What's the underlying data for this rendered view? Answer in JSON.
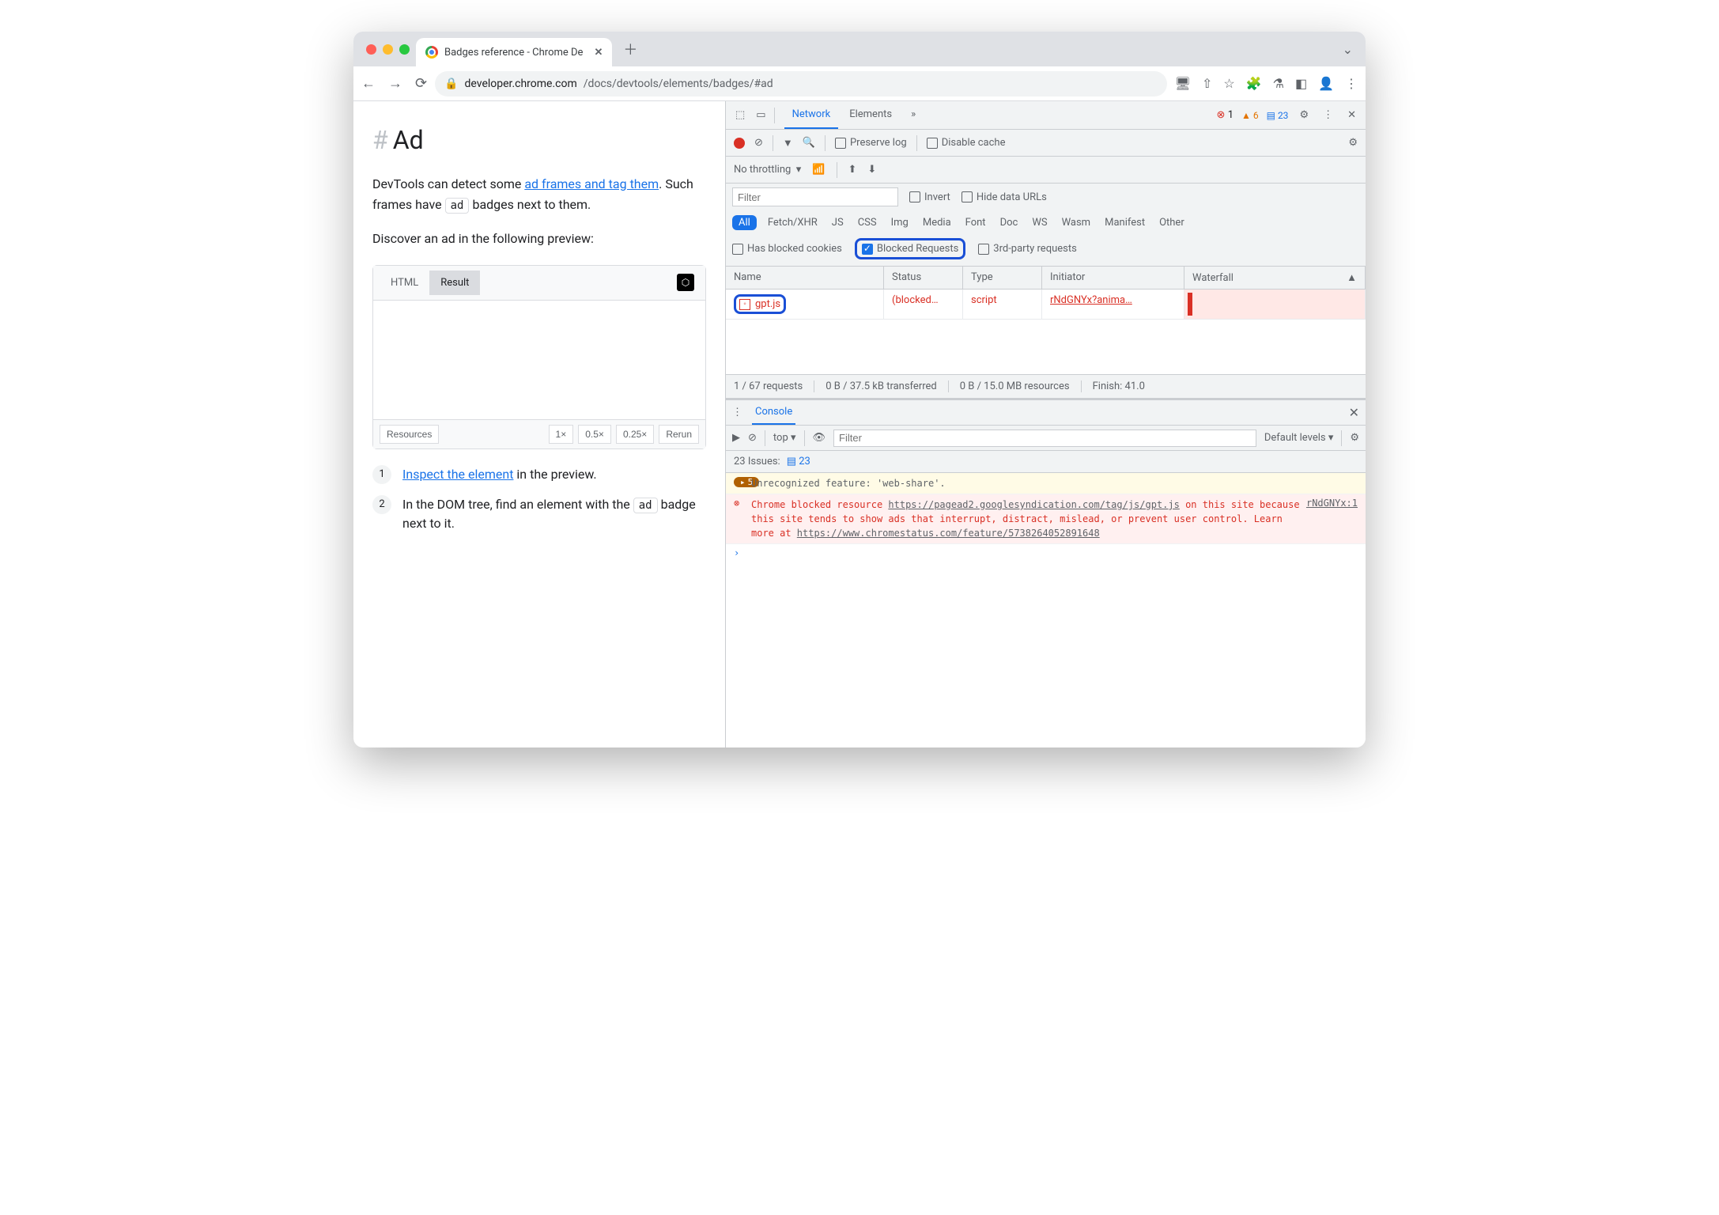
{
  "browser": {
    "tab_title": "Badges reference - Chrome De",
    "url_host": "developer.chrome.com",
    "url_path": "/docs/devtools/elements/badges/#ad"
  },
  "page": {
    "heading": "Ad",
    "p1_a": "DevTools can detect some ",
    "p1_link": "ad frames and tag them",
    "p1_b": ". Such frames have ",
    "p1_badge": "ad",
    "p1_c": " badges next to them.",
    "p2": "Discover an ad in the following preview:",
    "codepen": {
      "tab_html": "HTML",
      "tab_result": "Result",
      "footer": {
        "resources": "Resources",
        "z1": "1×",
        "z05": "0.5×",
        "z025": "0.25×",
        "rerun": "Rerun"
      }
    },
    "step1_link": "Inspect the element",
    "step1_rest": " in the preview.",
    "step2_a": "In the DOM tree, find an element with the ",
    "step2_badge": "ad",
    "step2_b": " badge next to it."
  },
  "devtools": {
    "tabs": {
      "network": "Network",
      "elements": "Elements",
      "more": "»"
    },
    "counts": {
      "errors": "1",
      "warnings": "6",
      "info": "23"
    },
    "toolbar": {
      "preserve": "Preserve log",
      "disable_cache": "Disable cache"
    },
    "throttling": "No throttling",
    "filter_placeholder": "Filter",
    "invert": "Invert",
    "hide_urls": "Hide data URLs",
    "types": [
      "All",
      "Fetch/XHR",
      "JS",
      "CSS",
      "Img",
      "Media",
      "Font",
      "Doc",
      "WS",
      "Wasm",
      "Manifest",
      "Other"
    ],
    "checks": {
      "blocked_cookies": "Has blocked cookies",
      "blocked_req": "Blocked Requests",
      "third_party": "3rd-party requests"
    },
    "columns": {
      "name": "Name",
      "status": "Status",
      "type": "Type",
      "initiator": "Initiator",
      "waterfall": "Waterfall"
    },
    "row": {
      "name": "gpt.js",
      "status": "(blocked…",
      "type": "script",
      "initiator": "rNdGNYx?anima…"
    },
    "status_bar": {
      "requests": "1 / 67 requests",
      "transferred": "0 B / 37.5 kB transferred",
      "resources": "0 B / 15.0 MB resources",
      "finish": "Finish: 41.0"
    }
  },
  "console": {
    "tab": "Console",
    "context": "top",
    "filter_placeholder": "Filter",
    "levels": "Default levels",
    "issues_label": "23 Issues:",
    "issues_count": "23",
    "warn_count": "5",
    "warn_text": "Unrecognized feature: 'web-share'.",
    "err_pre": "Chrome blocked resource ",
    "err_url1": "https://pagead2.googlesyndication.com/tag/js/gpt.js",
    "err_mid": " on this site because this site tends to show ads that interrupt, distract, mislead, or prevent user control. Learn more at ",
    "err_url2": "https://www.chromestatus.com/feature/5738264052891648",
    "err_src": "rNdGNYx:1"
  }
}
